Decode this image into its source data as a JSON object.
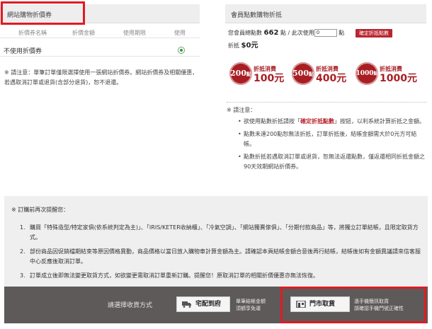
{
  "left": {
    "title": "網站購物折價券",
    "columns": [
      "折價券名稱",
      "折價金額",
      "使用期限",
      "使用"
    ],
    "no_coupon_label": "不使用折價券",
    "note": "※ 請注意：單筆訂單僅限選擇使用一張網站折價券。網站折價券及相關優惠，若遇取消訂單或退貨(含部分退貨)，恕不退還。"
  },
  "right": {
    "title": "會員點數購物折抵",
    "total_points_label": "您會員總點數",
    "total_points": "662",
    "points_unit_1": "點 / 此次使用",
    "use_input_value": "0",
    "points_unit_2": "點",
    "confirm_button": "確定折抵點數",
    "deduct_label": "折抵",
    "deduct_amount": "$0元",
    "offers": [
      {
        "points": "200",
        "unit": "點",
        "label": "折抵消費",
        "value": "100元"
      },
      {
        "points": "500",
        "unit": "點",
        "label": "折抵消費",
        "value": "400元"
      },
      {
        "points": "1000",
        "unit": "點",
        "label": "折抵消費",
        "value": "1000元"
      }
    ],
    "note_title": "※ 請注意：",
    "note_items": [
      {
        "before": "欲使用點數折抵請按「",
        "highlight": "確定折抵點數",
        "after": "」按鈕，以利系統計算折抵之金額。"
      },
      {
        "before": "點數未達200點恕無法折抵，訂單折抵後，結帳金額需大於0元方可結帳。",
        "highlight": "",
        "after": ""
      },
      {
        "before": "點數折抵若遇取消訂單或退貨，恕無法返還點數，僅返還相同折抵金額之90天效期網站折價券。",
        "highlight": "",
        "after": ""
      }
    ]
  },
  "reminder": {
    "title": "※ 訂購前再次提醒您：",
    "items": [
      {
        "num": "1.",
        "text": "購買「特殊造型/特定家俱(依系統判定為主)」、「IRIS/KETER收納櫃」、「冷氣空調」、「網站獨賣傢俱」、「分期付款商品」等，將獨立訂單結帳，且限定取貨方式。"
      },
      {
        "num": "2.",
        "text": "部份商品因促銷檔期結束等原因價格異動，商品價格以當日放入購物車計算金額為主。請確認本頁結帳金額合意後再行結帳，結帳後如有金額異議請來信客服中心反應後取消訂單。"
      },
      {
        "num": "3.",
        "text": "訂單成立後即無法變更取貨方式，如欲變更需取消訂單重新訂購。提醒您！原取消訂單的相關折價優惠亦無法恢復。"
      }
    ]
  },
  "delivery": {
    "prompt": "請選擇收貨方式",
    "home_button": "宅配到府",
    "home_desc_1": "單筆結帳金額",
    "home_desc_2": "須額享免運",
    "store_button": "門市取貨",
    "store_desc_1": "憑手機簡訊取貨",
    "store_desc_2": "請確認手機門號正確性"
  },
  "colors": {
    "accent_red": "#b8262f",
    "highlight_box": "#e01b22",
    "dark_bar": "#5d5a59",
    "panel_gray": "#efefef"
  }
}
